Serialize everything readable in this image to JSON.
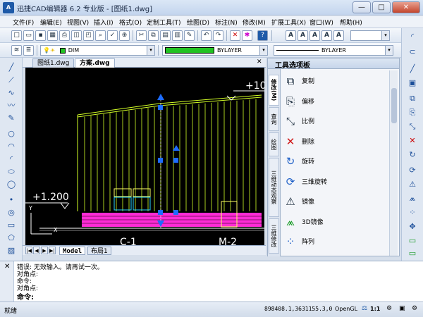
{
  "window": {
    "title": "迅捷CAD编辑器 6.2 专业版 - [图纸1.dwg]",
    "app_icon_text": "A",
    "minimize": "—",
    "maximize": "□",
    "close": "✕"
  },
  "menu": [
    "文件(F)",
    "编辑(E)",
    "视图(V)",
    "插入(I)",
    "格式(O)",
    "定制工具(T)",
    "绘图(D)",
    "标注(N)",
    "修改(M)",
    "扩展工具(X)",
    "窗口(W)",
    "帮助(H)"
  ],
  "toolbar2": {
    "layer_combo": "DIM",
    "color_combo": "BYLAYER",
    "linetype_combo": "BYLAYER"
  },
  "doc_tabs": [
    "图纸1.dwg",
    "方案.dwg"
  ],
  "doc_close": "✕",
  "drawing": {
    "labels": {
      "elev_right": "+10.",
      "elev_left": "+1.200",
      "axis_c": "C-1",
      "axis_m": "M-2",
      "axis_y": "Y",
      "axis_x": "X"
    },
    "colors": {
      "background": "#000000",
      "line": "#d4ff26",
      "white": "#ffffff",
      "magenta": "#ff2bd6",
      "cyan": "#29d6ff",
      "grip": "#1d6cff"
    }
  },
  "layout_tabs": {
    "nav": [
      "|◀",
      "◀",
      "▶",
      "▶|"
    ],
    "tabs": [
      "Model",
      "布局1"
    ]
  },
  "palette": {
    "title": "工具选项板",
    "side_tabs": [
      "修改(M)",
      "查询",
      "绘图",
      "三维动态观察",
      "三维修改"
    ],
    "items": [
      {
        "icon": "copy-icon",
        "glyph": "⧉",
        "label": "复制"
      },
      {
        "icon": "offset-icon",
        "glyph": "⎘",
        "label": "偏移"
      },
      {
        "icon": "scale-icon",
        "glyph": "⤡",
        "label": "比例"
      },
      {
        "icon": "erase-icon",
        "glyph": "✕",
        "label": "删除"
      },
      {
        "icon": "rotate-icon",
        "glyph": "↻",
        "label": "旋转"
      },
      {
        "icon": "3d-rotate-icon",
        "glyph": "⟳",
        "label": "三维旋转"
      },
      {
        "icon": "mirror-icon",
        "glyph": "⚠",
        "label": "镜像"
      },
      {
        "icon": "3d-mirror-icon",
        "glyph": "⩕",
        "label": "3D镜像"
      },
      {
        "icon": "array-icon",
        "glyph": "⁘",
        "label": "阵列"
      }
    ]
  },
  "command": {
    "lines": [
      "错误: 无效输入。请再试一次。",
      "对角点:",
      "命令:",
      "对角点:"
    ],
    "prompt": "命令:"
  },
  "status": {
    "text": "就绪",
    "coords": "898408.1,3631155.3,0",
    "opengl": "OpenGL",
    "scale": "1:1"
  }
}
